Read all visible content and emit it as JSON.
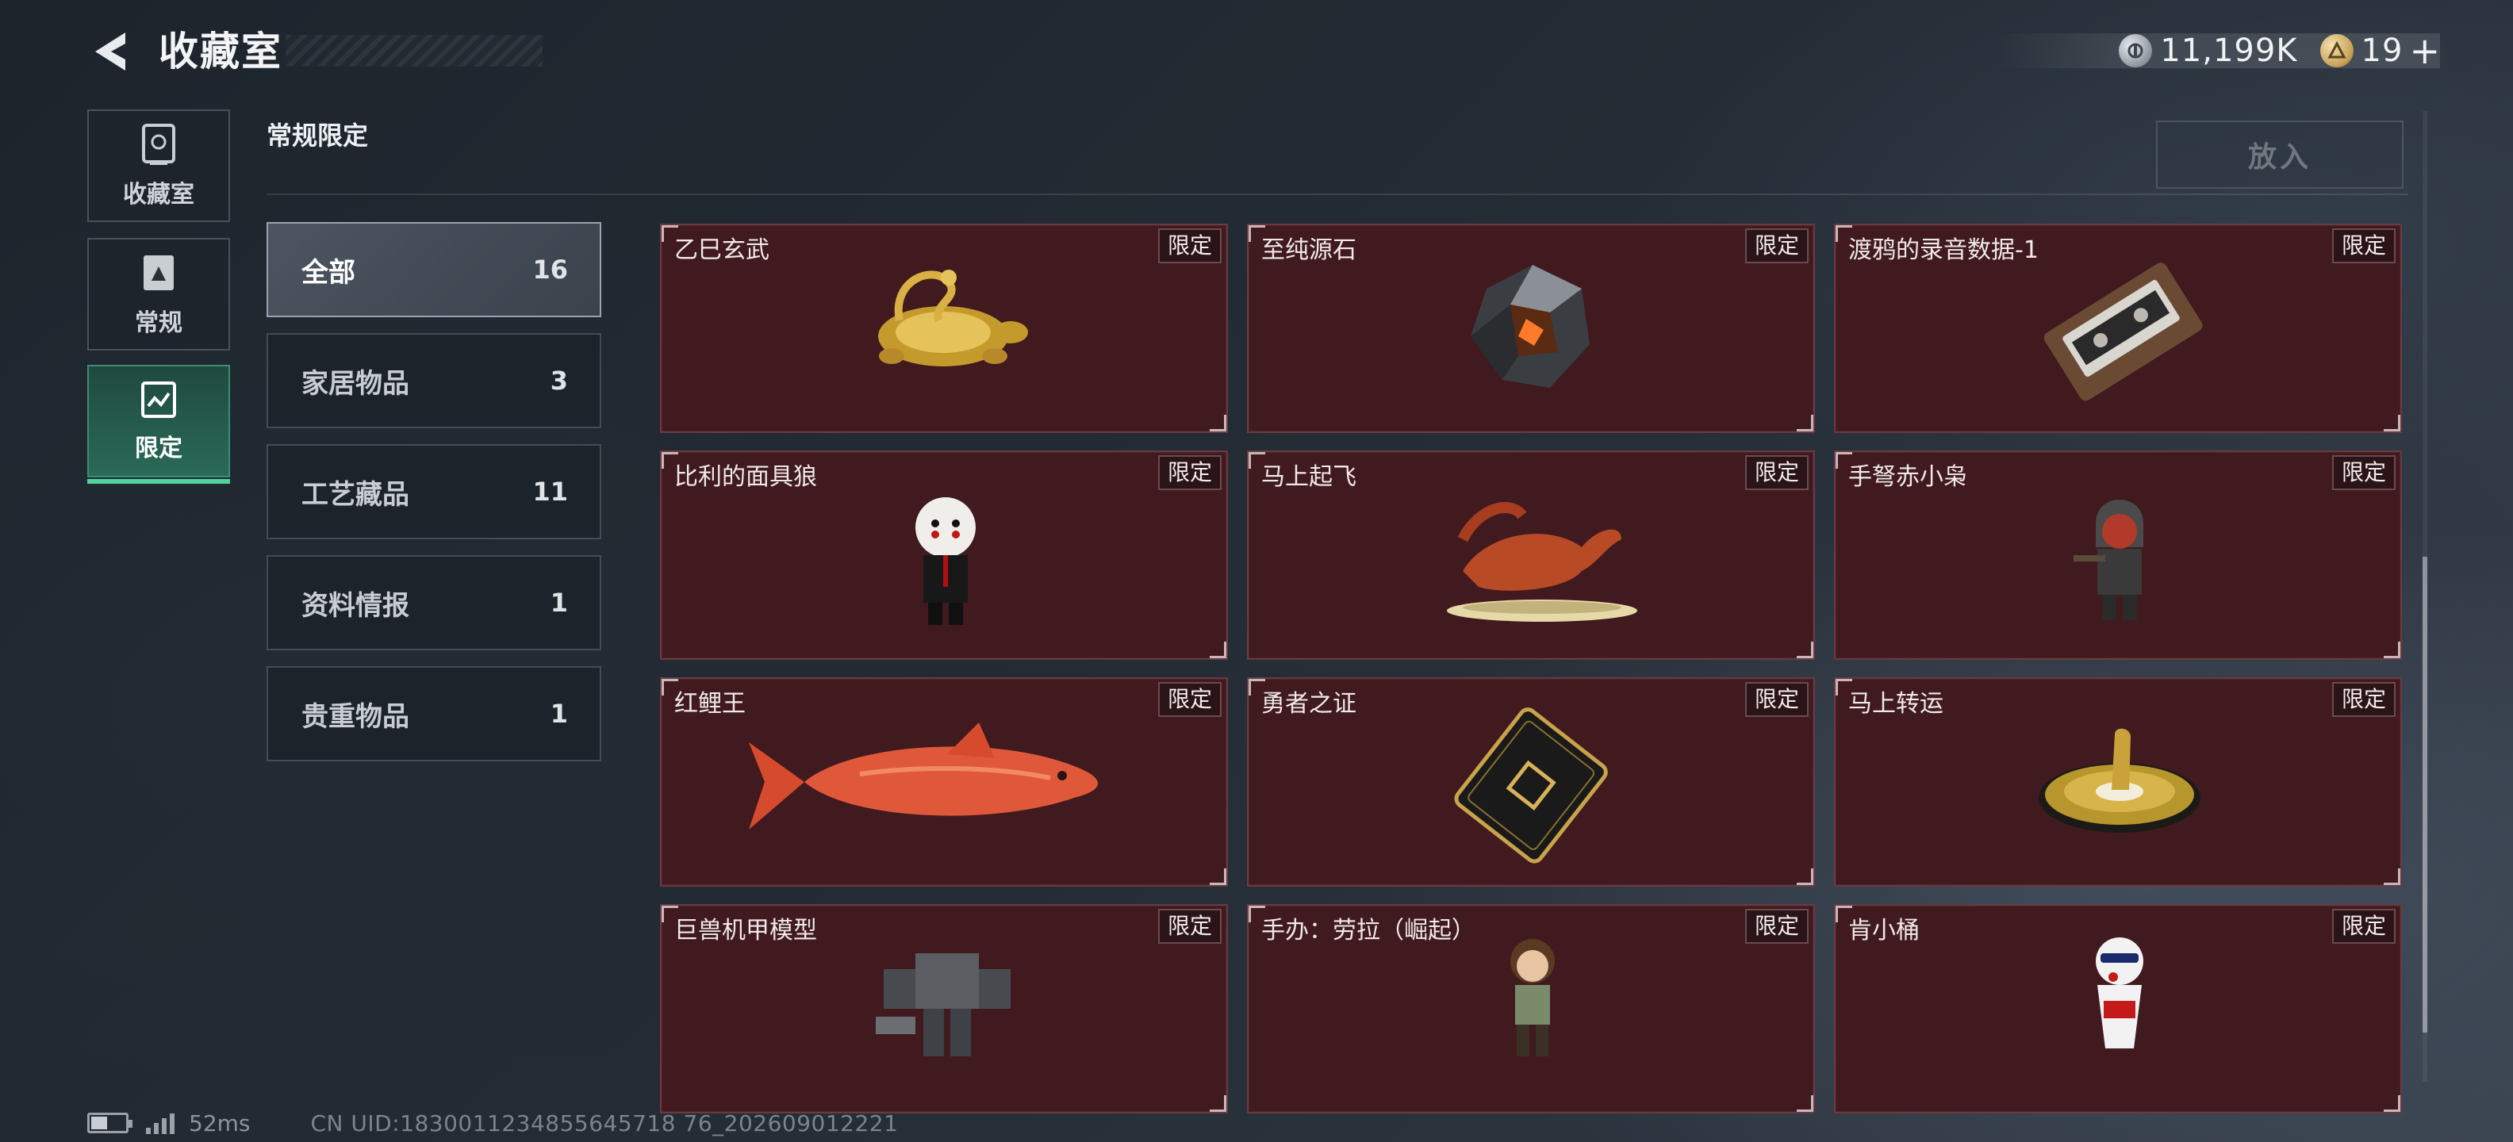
{
  "header": {
    "title": "收藏室",
    "currencies": [
      {
        "icon": "silver-coin-icon",
        "value": "11,199K"
      },
      {
        "icon": "gold-badge-icon",
        "value": "19"
      }
    ],
    "plus_label": "+"
  },
  "rail": {
    "items": [
      {
        "label": "收藏室",
        "icon": "collection-room-icon",
        "active": false
      },
      {
        "label": "常规",
        "icon": "regular-icon",
        "active": false
      },
      {
        "label": "限定",
        "icon": "limited-icon",
        "active": true
      }
    ]
  },
  "section": {
    "title": "常规限定",
    "place_button": "放入"
  },
  "categories": [
    {
      "label": "全部",
      "count": "16",
      "active": true
    },
    {
      "label": "家居物品",
      "count": "3",
      "active": false
    },
    {
      "label": "工艺藏品",
      "count": "11",
      "active": false
    },
    {
      "label": "资料情报",
      "count": "1",
      "active": false
    },
    {
      "label": "贵重物品",
      "count": "1",
      "active": false
    }
  ],
  "items": [
    {
      "name": "乙巳玄武",
      "badge": "限定",
      "icon": "golden-turtle-snake-icon"
    },
    {
      "name": "至纯源石",
      "badge": "限定",
      "icon": "pure-origin-stone-icon"
    },
    {
      "name": "渡鸦的录音数据-1",
      "badge": "限定",
      "icon": "cassette-tape-icon"
    },
    {
      "name": "比利的面具狼",
      "badge": "限定",
      "icon": "puppet-figure-icon"
    },
    {
      "name": "马上起飞",
      "badge": "限定",
      "icon": "flying-horse-icon"
    },
    {
      "name": "手弩赤小枭",
      "badge": "限定",
      "icon": "crossbow-owl-figure-icon"
    },
    {
      "name": "红鲤王",
      "badge": "限定",
      "icon": "red-carp-icon"
    },
    {
      "name": "勇者之证",
      "badge": "限定",
      "icon": "hero-card-icon"
    },
    {
      "name": "马上转运",
      "badge": "限定",
      "icon": "golden-horse-compass-icon"
    },
    {
      "name": "巨兽机甲模型",
      "badge": "限定",
      "icon": "mech-model-icon"
    },
    {
      "name": "手办：劳拉（崛起）",
      "badge": "限定",
      "icon": "lara-figure-icon"
    },
    {
      "name": "肯小桶",
      "badge": "限定",
      "icon": "bucket-figure-icon"
    }
  ],
  "footer": {
    "ping": "52ms",
    "uid": "CN UID:1830011234855645718 76_202609012221"
  }
}
